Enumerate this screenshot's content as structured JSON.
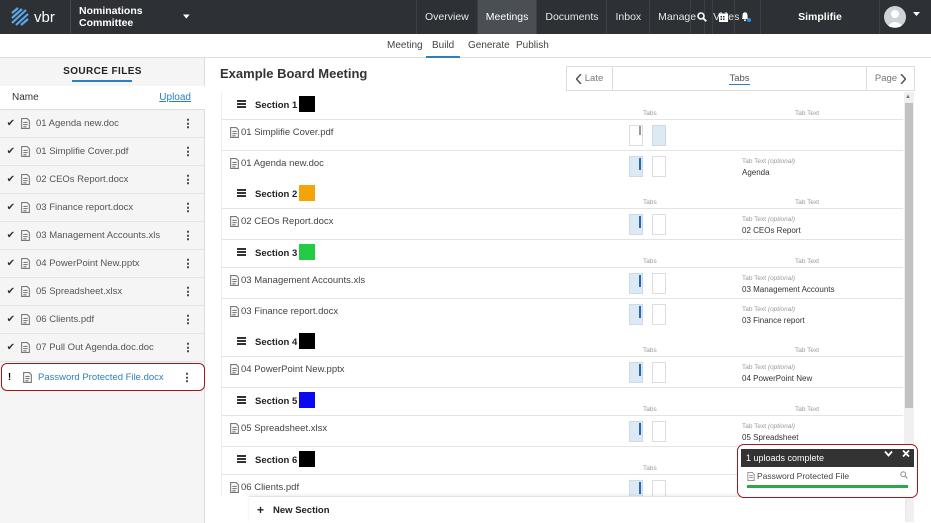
{
  "topbar": {
    "brand": "vbr",
    "committee": "Nominations Committee",
    "nav": [
      "Overview",
      "Meetings",
      "Documents",
      "Inbox",
      "Manage",
      "Votes"
    ],
    "active_nav": "Meetings",
    "org": "Simplifie",
    "icons": [
      "search-icon",
      "calendar-icon",
      "bell-icon"
    ]
  },
  "subnav": {
    "items": [
      "Meeting",
      "Build",
      "Generate",
      "Publish"
    ],
    "active": "Build"
  },
  "source_files": {
    "title": "SOURCE FILES",
    "col_name": "Name",
    "upload_label": "Upload",
    "files": [
      {
        "name": "01 Agenda new.doc",
        "status": "✔"
      },
      {
        "name": "01 Simplifie Cover.pdf",
        "status": "✔"
      },
      {
        "name": "02 CEOs Report.docx",
        "status": "✔"
      },
      {
        "name": "03 Finance report.docx",
        "status": "✔"
      },
      {
        "name": "03 Management Accounts.xls",
        "status": "✔"
      },
      {
        "name": "04 PowerPoint New.pptx",
        "status": "✔"
      },
      {
        "name": "05 Spreadsheet.xlsx",
        "status": "✔"
      },
      {
        "name": "06 Clients.pdf",
        "status": "✔"
      },
      {
        "name": "07 Pull Out Agenda.doc.doc",
        "status": "✔"
      },
      {
        "name": "Password Protected File.docx",
        "status": "!"
      }
    ]
  },
  "main": {
    "title": "Example Board Meeting",
    "pager": {
      "late": "Late",
      "tabs": "Tabs",
      "page": "Page"
    },
    "tabs_label": "Tabs",
    "tab_text_label": "Tab Text",
    "tab_text_optional_prefix": "Tab Text",
    "tab_text_optional_suffix": "(optional)",
    "sections": [
      {
        "name": "Section 1",
        "color": "#000000"
      },
      {
        "name": "Section 2",
        "color": "#f5a30a"
      },
      {
        "name": "Section 3",
        "color": "#22cc44"
      },
      {
        "name": "Section 4",
        "color": "#000000"
      },
      {
        "name": "Section 5",
        "color": "#0a0aee"
      },
      {
        "name": "Section 6",
        "color": "#000000"
      }
    ],
    "rows": [
      {
        "name": "01 Simplifie Cover.pdf",
        "tab_text": ""
      },
      {
        "name": "01 Agenda new.doc",
        "tab_text": "Agenda"
      },
      {
        "name": "02 CEOs Report.docx",
        "tab_text": "02 CEOs Report"
      },
      {
        "name": "03 Management Accounts.xls",
        "tab_text": "03 Management Accounts"
      },
      {
        "name": "03 Finance report.docx",
        "tab_text": "03 Finance report"
      },
      {
        "name": "04 PowerPoint New.pptx",
        "tab_text": "04 PowerPoint New"
      },
      {
        "name": "05 Spreadsheet.xlsx",
        "tab_text": "05 Spreadsheet"
      },
      {
        "name": "06 Clients.pdf",
        "tab_text": ""
      }
    ],
    "new_section": "New Section"
  },
  "upload_popup": {
    "title": "1 uploads complete",
    "file": "Password Protected File",
    "progress": 1.0,
    "accent": "#2aa84a"
  }
}
